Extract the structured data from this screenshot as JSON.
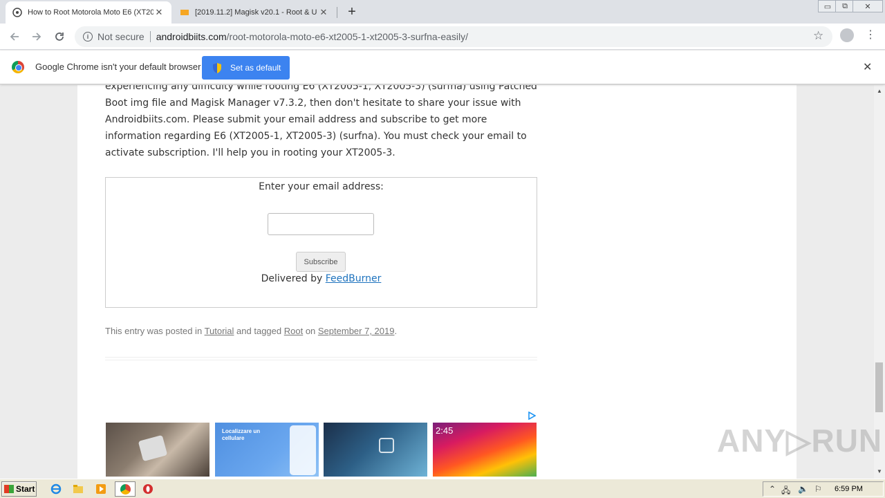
{
  "browser": {
    "tabs": [
      {
        "title": "How to Root Motorola Moto E6 (XT20",
        "close": "✕"
      },
      {
        "title": "[2019.11.2] Magisk v20.1 - Root & U",
        "close": "✕"
      }
    ],
    "new_tab": "+",
    "window_controls": {
      "minimize": "▭",
      "restore": "⧉",
      "close": "✕"
    },
    "address": {
      "security_text": "Not secure",
      "domain": "androidbiits.com",
      "path": "/root-motorola-moto-e6-xt2005-1-xt2005-3-surfna-easily/"
    }
  },
  "infobar": {
    "message": "Google Chrome isn't your default browser",
    "button": "Set as default",
    "close": "✕"
  },
  "article": {
    "paragraph": "experiencing any difficulty while rooting E6 (XT2005-1, XT2005-3) (surfna) using Patched Boot img file and Magisk Manager v7.3.2, then don't hesitate to share your issue with Androidbiits.com. Please submit your email address and subscribe to get more information regarding E6 (XT2005-1, XT2005-3) (surfna). You must check your email to activate subscription. I'll help you in rooting your XT2005-3."
  },
  "subscribe": {
    "label": "Enter your email address:",
    "input_value": "",
    "button": "Subscribe",
    "delivered_prefix": "Delivered by ",
    "delivered_link": "FeedBurner"
  },
  "entry_meta": {
    "prefix": "This entry was posted in ",
    "category": "Tutorial",
    "tagged": " and tagged ",
    "tag": "Root",
    "on": " on ",
    "date": "September 7, 2019",
    "end": "."
  },
  "ads": {
    "ad2_text": "Localizzare un cellulare",
    "ad4_text": "2:45"
  },
  "watermark": "ANY▷RUN",
  "taskbar": {
    "start": "Start",
    "clock": "6:59 PM"
  },
  "colors": {
    "accent_blue": "#3c83f0",
    "link_blue": "#1e73be"
  }
}
